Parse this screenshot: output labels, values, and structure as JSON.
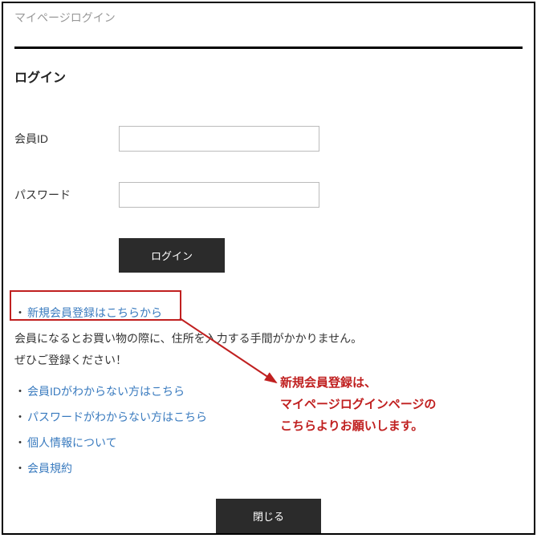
{
  "titleBar": "マイページログイン",
  "heading": "ログイン",
  "form": {
    "memberIdLabel": "会員ID",
    "memberIdValue": "",
    "passwordLabel": "パスワード",
    "passwordValue": "",
    "loginButton": "ログイン"
  },
  "links": {
    "newRegistration": "新規会員登録はこちらから",
    "desc1": "会員になるとお買い物の際に、住所を入力する手間がかかりません。",
    "desc2": "ぜひご登録ください！",
    "forgotId": "会員IDがわからない方はこちら",
    "forgotPassword": "パスワードがわからない方はこちら",
    "privacy": "個人情報について",
    "terms": "会員規約"
  },
  "annotation": {
    "line1": "新規会員登録は、",
    "line2": "マイページログインページの",
    "line3": "こちらよりお願いします。"
  },
  "closeButton": "閉じる"
}
